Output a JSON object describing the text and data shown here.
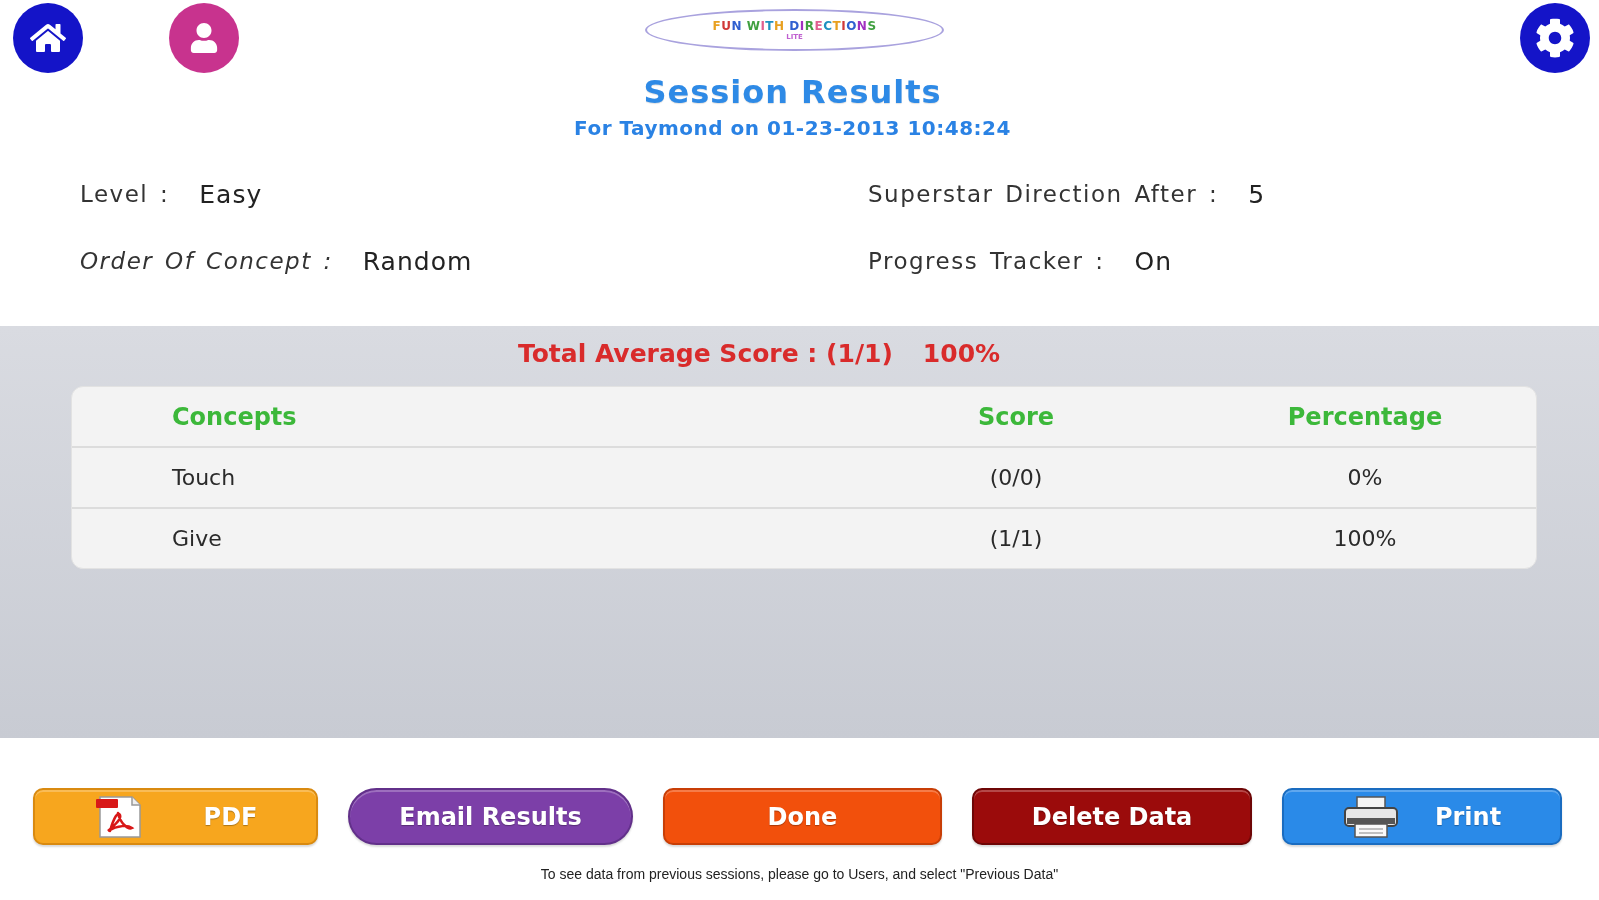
{
  "toolbar": {
    "logo": {
      "title": "FUN WITH DIRECTIONS",
      "subtitle": "LITE"
    }
  },
  "header": {
    "title": "Session Results",
    "subtitle": "For Taymond on 01-23-2013 10:48:24"
  },
  "settings": [
    {
      "label": "Level :",
      "value": "Easy"
    },
    {
      "label": "Superstar Direction After :",
      "value": "5"
    },
    {
      "label": "Order Of Concept :",
      "value": "Random"
    },
    {
      "label": "Progress Tracker :",
      "value": "On"
    }
  ],
  "total_score": {
    "label": "Total Average Score : (1/1)",
    "value": "100%"
  },
  "table": {
    "columns": [
      "Concepts",
      "Score",
      "Percentage"
    ],
    "rows": [
      [
        "Touch",
        "(0/0)",
        "0%"
      ],
      [
        "Give",
        "(1/1)",
        "100%"
      ]
    ]
  },
  "buttons": [
    {
      "label": "PDF",
      "kind": "pdf"
    },
    {
      "label": "Email Results",
      "kind": "email"
    },
    {
      "label": "Done",
      "kind": "done"
    },
    {
      "label": "Delete Data",
      "kind": "delete"
    },
    {
      "label": "Print",
      "kind": "print"
    }
  ],
  "footer_note": "To see data from previous sessions, please go to Users, and select \"Previous Data\""
}
